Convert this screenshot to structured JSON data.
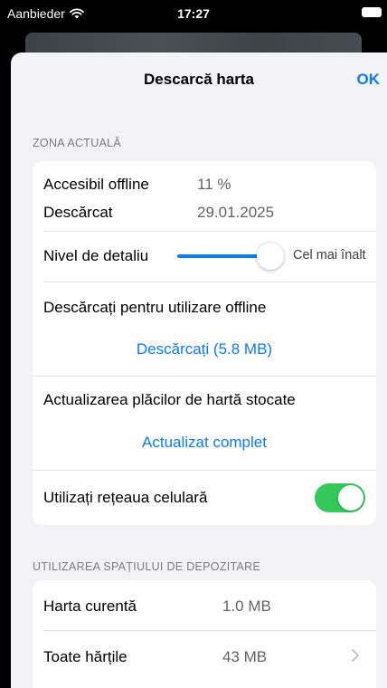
{
  "status_bar": {
    "carrier": "Aanbieder",
    "time": "17:27"
  },
  "nav": {
    "title": "Descarcă harta",
    "ok_label": "OK"
  },
  "current_zone": {
    "header": "ZONA ACTUALĂ",
    "offline_label": "Accesibil offline",
    "offline_value": "11 %",
    "downloaded_label": "Descărcat",
    "downloaded_value": "29.01.2025",
    "detail_label": "Nivel de detaliu",
    "detail_value_label": "Cel mai înalt",
    "detail_level": 1.0,
    "download_title": "Descărcați pentru utilizare offline",
    "download_button": "Descărcați (5.8 MB)",
    "update_title": "Actualizarea plăcilor de hartă stocate",
    "update_button": "Actualizat complet",
    "cellular_label": "Utilizați rețeaua celulară",
    "cellular_on": true
  },
  "storage": {
    "header": "UTILIZAREA SPAȚIULUI DE DEPOZITARE",
    "current_map_label": "Harta curentă",
    "current_map_value": "1.0 MB",
    "all_maps_label": "Toate hărțile",
    "all_maps_value": "43 MB"
  },
  "colors": {
    "accent": "#0a7aff",
    "toggle_on": "#34c759",
    "background": "#f2f2f7"
  }
}
